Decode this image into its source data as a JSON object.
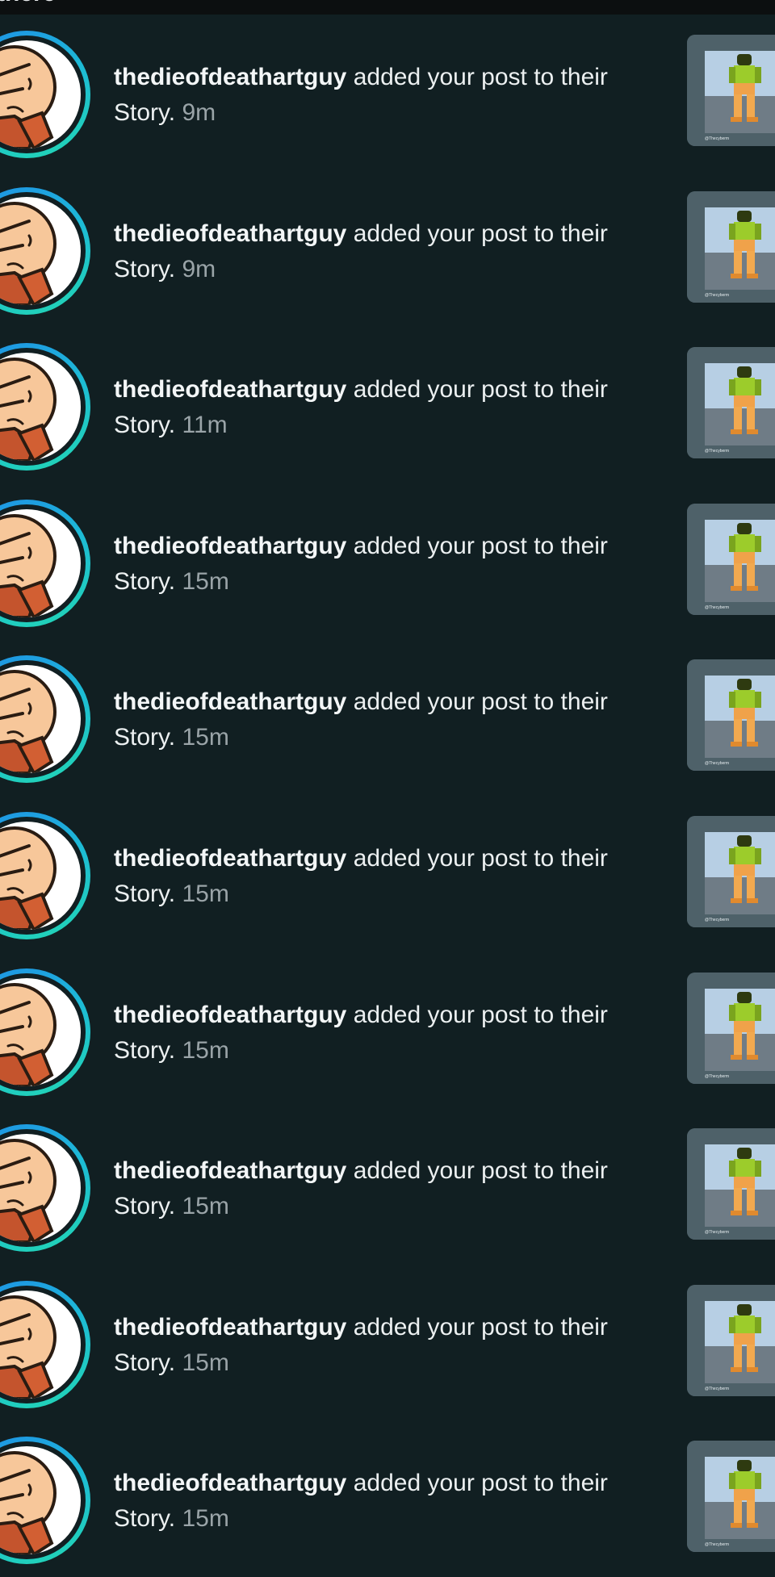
{
  "header": {
    "clipped_title": "there"
  },
  "notifications": [
    {
      "username": "thedieofdeathartguy",
      "action": "added your post to their Story.",
      "time": "9m"
    },
    {
      "username": "thedieofdeathartguy",
      "action": "added your post to their Story.",
      "time": "9m"
    },
    {
      "username": "thedieofdeathartguy",
      "action": "added your post to their Story.",
      "time": "11m"
    },
    {
      "username": "thedieofdeathartguy",
      "action": "added your post to their Story.",
      "time": "15m"
    },
    {
      "username": "thedieofdeathartguy",
      "action": "added your post to their Story.",
      "time": "15m"
    },
    {
      "username": "thedieofdeathartguy",
      "action": "added your post to their Story.",
      "time": "15m"
    },
    {
      "username": "thedieofdeathartguy",
      "action": "added your post to their Story.",
      "time": "15m"
    },
    {
      "username": "thedieofdeathartguy",
      "action": "added your post to their Story.",
      "time": "15m"
    },
    {
      "username": "thedieofdeathartguy",
      "action": "added your post to their Story.",
      "time": "15m"
    },
    {
      "username": "thedieofdeathartguy",
      "action": "added your post to their Story.",
      "time": "15m"
    }
  ],
  "thumbnail": {
    "watermark": "@Thecyberm"
  },
  "colors": {
    "background": "#111f22",
    "story_ring_start": "#1f8fe6",
    "story_ring_end": "#22d6b3",
    "timestamp": "#9aa4a8"
  },
  "icons": {
    "avatar": "cartoon-face-avatar-icon",
    "thumbnail": "post-thumbnail-image"
  }
}
